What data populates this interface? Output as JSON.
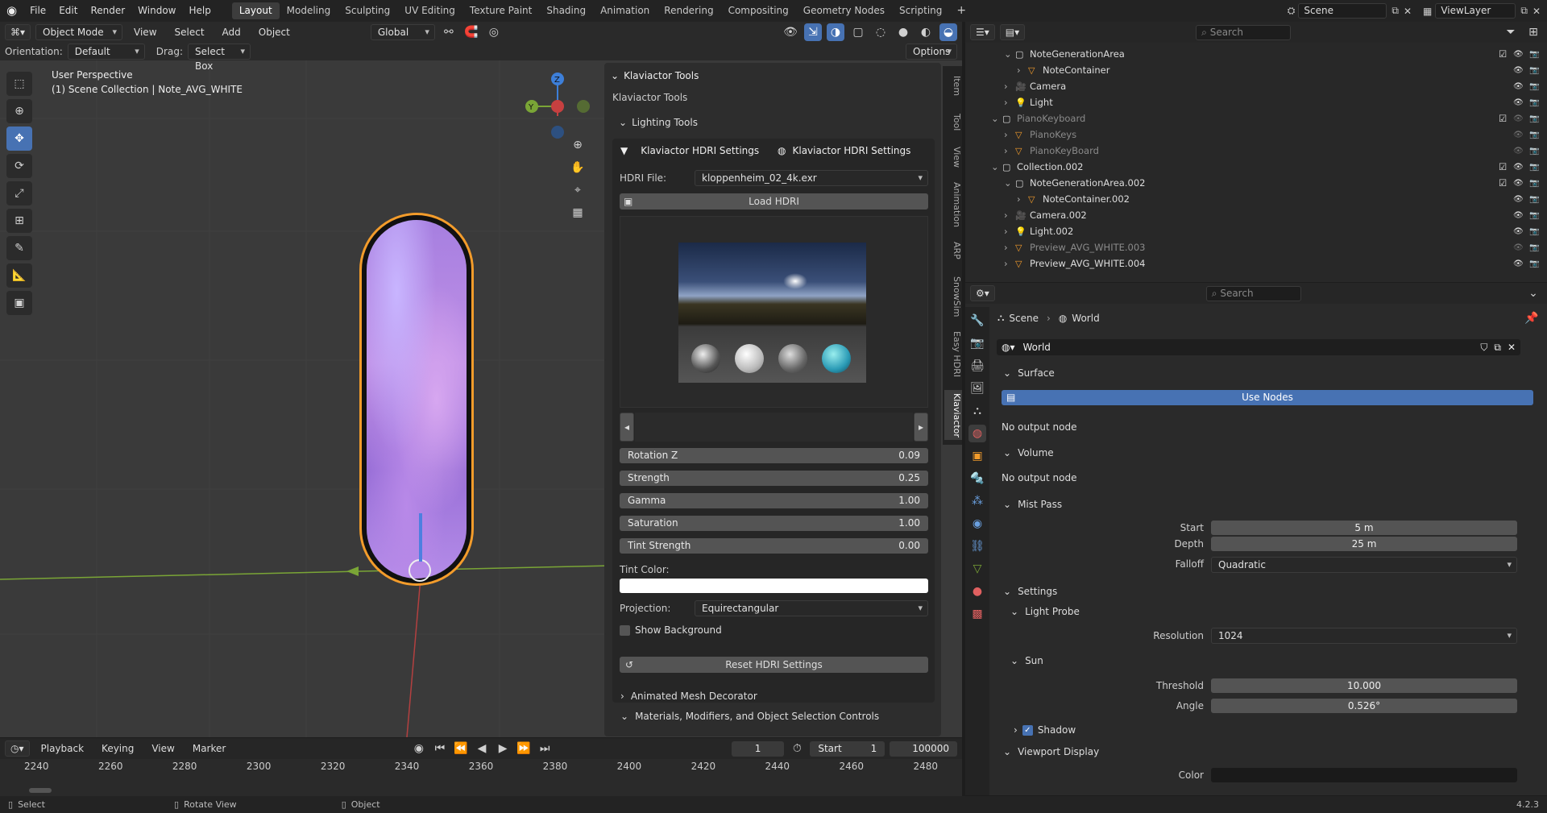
{
  "menu": {
    "items": [
      "File",
      "Edit",
      "Render",
      "Window",
      "Help"
    ]
  },
  "workspaces": [
    "Layout",
    "Modeling",
    "Sculpting",
    "UV Editing",
    "Texture Paint",
    "Shading",
    "Animation",
    "Rendering",
    "Compositing",
    "Geometry Nodes",
    "Scripting"
  ],
  "active_workspace": "Layout",
  "scene": {
    "name": "Scene",
    "view_layer": "ViewLayer"
  },
  "viewport_header": {
    "mode": "Object Mode",
    "menus": [
      "View",
      "Select",
      "Add",
      "Object"
    ],
    "transform": "Global",
    "options": "Options"
  },
  "tool_settings": {
    "orientation_label": "Orientation:",
    "orientation_value": "Default",
    "drag_label": "Drag:",
    "drag_value": "Select Box"
  },
  "viewport": {
    "title": "User Perspective",
    "subtitle": "(1) Scene Collection | Note_AVG_WHITE",
    "gizmo": {
      "z": "Z",
      "y": "Y"
    }
  },
  "npanel": {
    "header": "Klaviactor Tools",
    "sub": "Klaviactor Tools",
    "lighting": "Lighting Tools",
    "hdri_header_left": "Klaviactor HDRI Settings",
    "hdri_header_right": "Klaviactor HDRI Settings",
    "hdri_file_label": "HDRI File:",
    "hdri_file": "kloppenheim_02_4k.exr",
    "load_button": "Load HDRI",
    "sliders": [
      {
        "label": "Rotation Z",
        "value": "0.09"
      },
      {
        "label": "Strength",
        "value": "0.25"
      },
      {
        "label": "Gamma",
        "value": "1.00"
      },
      {
        "label": "Saturation",
        "value": "1.00"
      },
      {
        "label": "Tint Strength",
        "value": "0.00"
      }
    ],
    "tint_label": "Tint Color:",
    "projection_label": "Projection:",
    "projection": "Equirectangular",
    "show_background": "Show Background",
    "reset_button": "Reset HDRI Settings",
    "animated": "Animated Mesh Decorator",
    "materials": "Materials, Modifiers, and Object Selection Controls",
    "tabs": [
      "Item",
      "Tool",
      "View",
      "Animation",
      "ARP",
      "SnowSim",
      "Easy HDRI",
      "Klaviactor"
    ]
  },
  "timeline": {
    "menus": [
      "Playback",
      "Keying",
      "View",
      "Marker"
    ],
    "current": "1",
    "start_label": "Start",
    "start": "1",
    "end": "100000",
    "ticks": [
      "2240",
      "2260",
      "2280",
      "2300",
      "2320",
      "2340",
      "2360",
      "2380",
      "2400",
      "2420",
      "2440",
      "2460",
      "2480"
    ]
  },
  "statusbar": {
    "items": [
      "Select",
      "Rotate View",
      "Object"
    ],
    "version": "4.2.3"
  },
  "outliner": {
    "search_placeholder": "Search",
    "rows": [
      {
        "name": "NoteGenerationArea",
        "indent": 2,
        "type": "coll",
        "dim": false
      },
      {
        "name": "NoteContainer",
        "indent": 3,
        "type": "mesh",
        "dim": false
      },
      {
        "name": "Camera",
        "indent": 2,
        "type": "cam",
        "dim": false
      },
      {
        "name": "Light",
        "indent": 2,
        "type": "light",
        "dim": false
      },
      {
        "name": "PianoKeyboard",
        "indent": 1,
        "type": "coll",
        "dim": true
      },
      {
        "name": "PianoKeys",
        "indent": 2,
        "type": "mesh",
        "dim": true
      },
      {
        "name": "PianoKeyBoard",
        "indent": 2,
        "type": "mesh",
        "dim": true
      },
      {
        "name": "Collection.002",
        "indent": 1,
        "type": "coll",
        "dim": false
      },
      {
        "name": "NoteGenerationArea.002",
        "indent": 2,
        "type": "coll",
        "dim": false
      },
      {
        "name": "NoteContainer.002",
        "indent": 3,
        "type": "mesh",
        "dim": false
      },
      {
        "name": "Camera.002",
        "indent": 2,
        "type": "cam",
        "dim": false
      },
      {
        "name": "Light.002",
        "indent": 2,
        "type": "light",
        "dim": false
      },
      {
        "name": "Preview_AVG_WHITE.003",
        "indent": 2,
        "type": "mesh",
        "dim": true
      },
      {
        "name": "Preview_AVG_WHITE.004",
        "indent": 2,
        "type": "mesh",
        "dim": false
      }
    ]
  },
  "properties": {
    "search_placeholder": "Search",
    "breadcrumb": [
      "Scene",
      "World"
    ],
    "world_name": "World",
    "surface": "Surface",
    "use_nodes": "Use Nodes",
    "no_output": "No output node",
    "volume": "Volume",
    "no_output2": "No output node",
    "mist": "Mist Pass",
    "mist_start_label": "Start",
    "mist_start": "5 m",
    "mist_depth_label": "Depth",
    "mist_depth": "25 m",
    "mist_falloff_label": "Falloff",
    "mist_falloff": "Quadratic",
    "settings": "Settings",
    "light_probe": "Light Probe",
    "resolution_label": "Resolution",
    "resolution": "1024",
    "sun": "Sun",
    "threshold_label": "Threshold",
    "threshold": "10.000",
    "angle_label": "Angle",
    "angle": "0.526°",
    "shadow": "Shadow",
    "viewport_display": "Viewport Display",
    "color_label": "Color"
  },
  "colors": {
    "accent": "#4772b3",
    "orange": "#f39c2b",
    "grid_green": "#7aa536",
    "grid_red": "#b34040"
  }
}
